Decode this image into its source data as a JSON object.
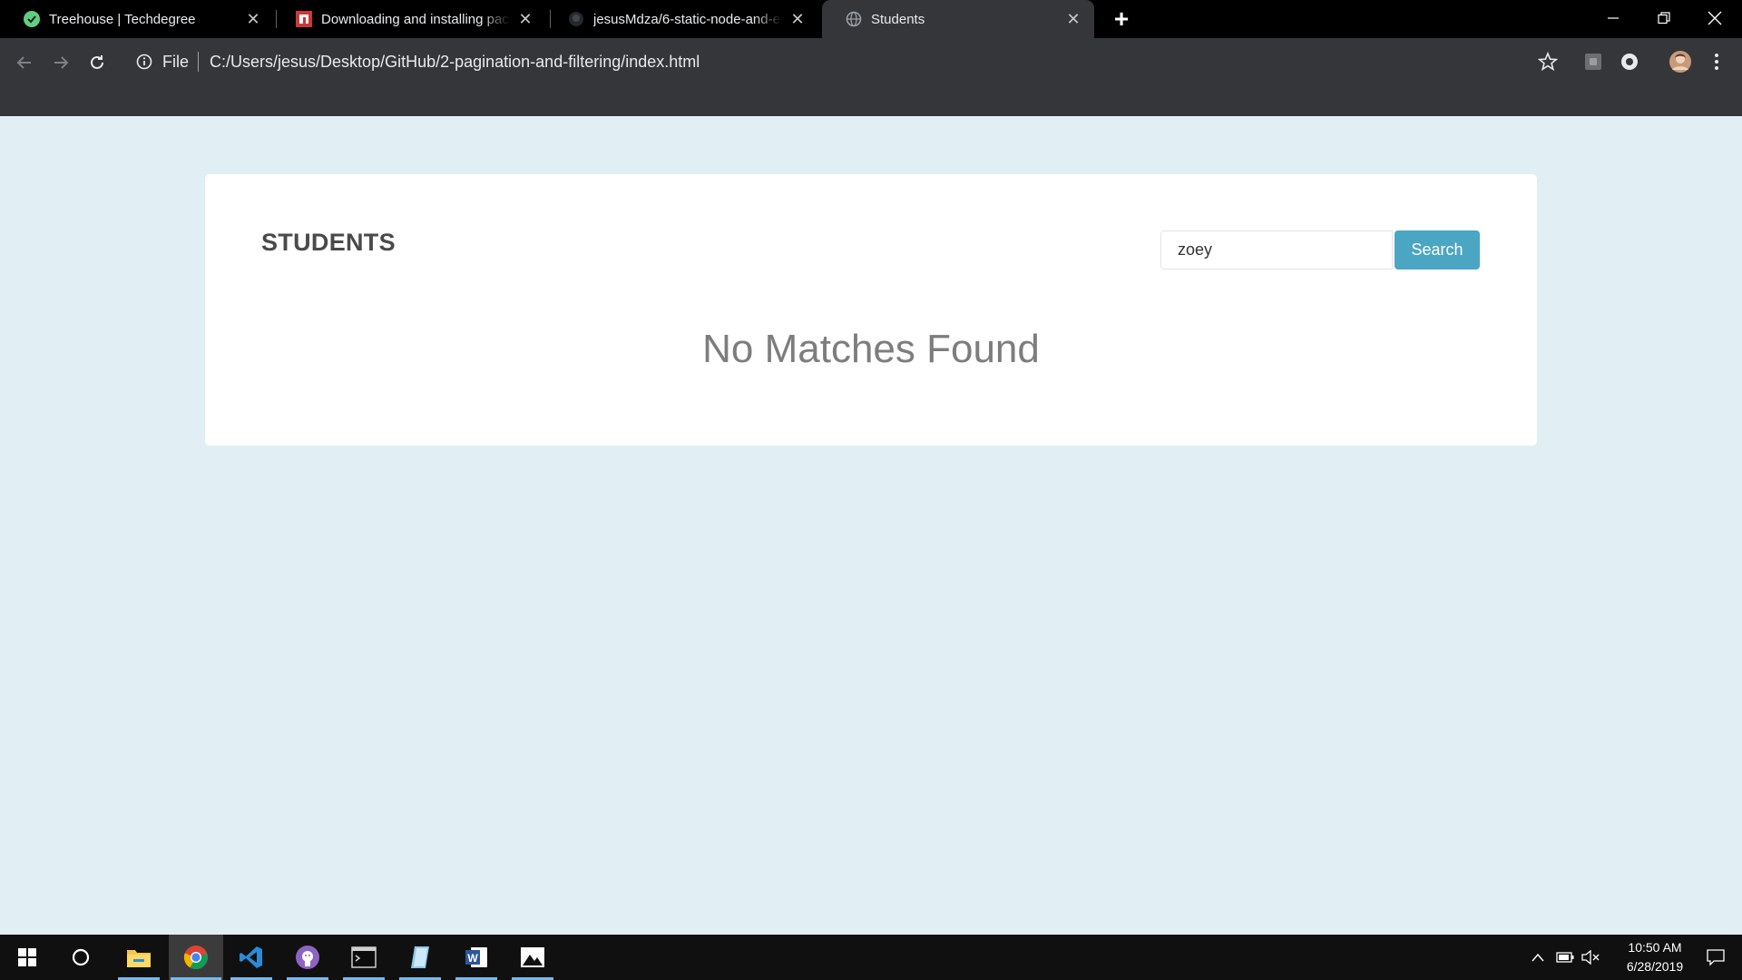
{
  "browser": {
    "tabs": [
      {
        "title": "Treehouse | Techdegree",
        "icon": "treehouse-icon",
        "active": false
      },
      {
        "title": "Downloading and installing packages",
        "icon": "npm-icon",
        "active": false
      },
      {
        "title": "jesusMdza/6-static-node-and-express",
        "icon": "github-icon",
        "active": false
      },
      {
        "title": "Students",
        "icon": "globe-icon",
        "active": true
      }
    ],
    "address": {
      "scheme_label": "File",
      "url": "C:/Users/jesus/Desktop/GitHub/2-pagination-and-filtering/index.html"
    }
  },
  "page": {
    "title": "STUDENTS",
    "search": {
      "value": "zoey",
      "button_label": "Search"
    },
    "message": "No Matches Found"
  },
  "taskbar": {
    "apps": [
      "start-icon",
      "cortana-icon",
      "file-explorer-icon",
      "chrome-icon",
      "vscode-icon",
      "github-desktop-icon",
      "terminal-icon",
      "notes-icon",
      "word-icon",
      "photos-icon"
    ],
    "clock": {
      "time": "10:50 AM",
      "date": "6/28/2019"
    }
  },
  "colors": {
    "page_background": "#e1eff4",
    "accent": "#4ba6c3",
    "chrome_dark": "#35363a"
  }
}
